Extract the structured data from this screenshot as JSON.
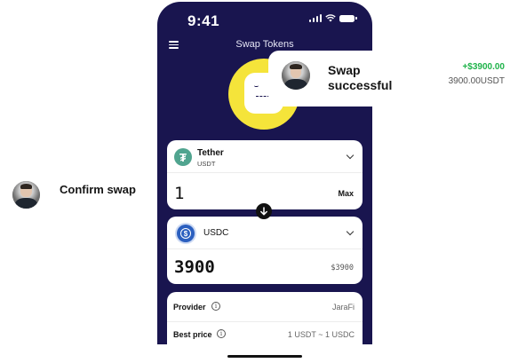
{
  "status_bar": {
    "time": "9:41"
  },
  "header": {
    "title": "Swap Tokens"
  },
  "from_token": {
    "name": "Tether",
    "symbol": "USDT",
    "amount": "1",
    "max_label": "Max"
  },
  "to_token": {
    "name": "USDC",
    "amount": "3900",
    "usd_value": "$3900"
  },
  "details": {
    "rows": [
      {
        "label": "Provider",
        "value": "JaraFi"
      },
      {
        "label": "Best price",
        "value": "1 USDT ~ 1 USDC"
      }
    ]
  },
  "notification": {
    "title": "Swap successful",
    "amount_change": "+$3900.00",
    "amount_token": "3900.00USDT"
  },
  "confirm": {
    "label": "Confirm swap"
  },
  "colors": {
    "phone_bg": "#19154f",
    "accent_yellow": "#f5e43a",
    "success_green": "#1fb34a"
  }
}
